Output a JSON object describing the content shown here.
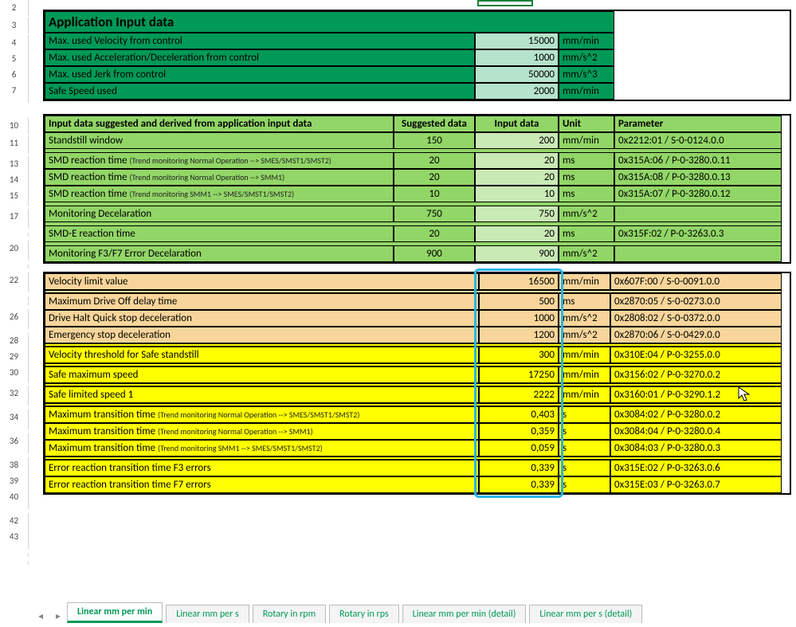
{
  "rownums": [
    "2",
    "3",
    "4",
    "5",
    "6",
    "7",
    "10",
    "11",
    "13",
    "14",
    "15",
    "17",
    "20",
    "22",
    "26",
    "28",
    "29",
    "30",
    "32",
    "34",
    "36",
    "38",
    "39",
    "40",
    "42",
    "43"
  ],
  "rownums_short_after": [
    "7",
    "11",
    "15",
    "17",
    "20",
    "22",
    "26",
    "30",
    "32",
    "34",
    "36",
    "40",
    "43"
  ],
  "section1": {
    "title": "Application Input data",
    "rows": [
      {
        "label": "Max. used Velocity from control",
        "value": "15000",
        "unit": "mm/min"
      },
      {
        "label": "Max. used Acceleration/Deceleration from control",
        "value": "1000",
        "unit": "mm/s^2"
      },
      {
        "label": "Max. used Jerk from control",
        "value": "50000",
        "unit": "mm/s^3"
      },
      {
        "label": "Safe Speed used",
        "value": "2000",
        "unit": "mm/min"
      }
    ]
  },
  "section2": {
    "headers": {
      "label": "Input data suggested and derived from application input data",
      "suggested": "Suggested data",
      "input": "Input data",
      "unit": "Unit",
      "param": "Parameter"
    },
    "rows": [
      {
        "label": "Standstill window",
        "sub": "",
        "suggested": "150",
        "value": "200",
        "unit": "mm/min",
        "param": "0x2212:01 / S-0-0124.0.0"
      },
      null,
      {
        "label": "SMD reaction time ",
        "sub": "(Trend monitoring Normal Operation --> SMES/SMST1/SMST2)",
        "suggested": "20",
        "value": "20",
        "unit": "ms",
        "param": "0x315A:06 / P-0-3280.0.11"
      },
      {
        "label": "SMD reaction time ",
        "sub": "(Trend monitoring Normal Operation --> SMM1)",
        "suggested": "20",
        "value": "20",
        "unit": "ms",
        "param": "0x315A:08 / P-0-3280.0.13"
      },
      {
        "label": "SMD reaction time ",
        "sub": "(Trend monitoring SMM1 --> SMES/SMST1/SMST2)",
        "suggested": "10",
        "value": "10",
        "unit": "ms",
        "param": "0x315A:07 / P-0-3280.0.12"
      },
      null,
      {
        "label": "Monitoring Decelaration",
        "sub": "",
        "suggested": "750",
        "value": "750",
        "unit": "mm/s^2",
        "param": ""
      },
      null,
      {
        "label": "SMD-E reaction time",
        "sub": "",
        "suggested": "20",
        "value": "20",
        "unit": "ms",
        "param": "0x315F:02 / P-0-3263.0.3"
      },
      null,
      {
        "label": "Monitoring F3/F7 Error Decelaration",
        "sub": "",
        "suggested": "900",
        "value": "900",
        "unit": "mm/s^2",
        "param": ""
      }
    ]
  },
  "section3": {
    "blocks": [
      {
        "color": "tan",
        "rows": [
          {
            "label": "Velocity limit value",
            "sub": "",
            "value": "16500",
            "unit": "mm/min",
            "param": "0x607F:00 / S-0-0091.0.0"
          }
        ]
      },
      {
        "color": "tan",
        "rows": [
          {
            "label": "Maximum Drive Off delay time",
            "sub": "",
            "value": "500",
            "unit": "ms",
            "param": "0x2870:05 / S-0-0273.0.0"
          },
          {
            "label": "Drive Halt Quick stop deceleration",
            "sub": "",
            "value": "1000",
            "unit": "mm/s^2",
            "param": "0x2808:02 / S-0-0372.0.0"
          },
          {
            "label": "Emergency stop deceleration",
            "sub": "",
            "value": "1200",
            "unit": "mm/s^2",
            "param": "0x2870:06 / S-0-0429.0.0"
          }
        ]
      },
      {
        "color": "yel",
        "rows": [
          {
            "label": "Velocity threshold for Safe standstill",
            "sub": "",
            "value": "300",
            "unit": "mm/min",
            "param": "0x310E:04 / P-0-3255.0.0"
          }
        ]
      },
      {
        "color": "yel",
        "rows": [
          {
            "label": "Safe maximum speed",
            "sub": "",
            "value": "17250",
            "unit": "mm/min",
            "param": "0x3156:02 / P-0-3270.0.2"
          }
        ]
      },
      {
        "color": "yel",
        "rows": [
          {
            "label": "Safe limited speed 1",
            "sub": "",
            "value": "2222",
            "unit": "mm/min",
            "param": "0x3160:01 / P-0-3290.1.2"
          }
        ]
      },
      {
        "color": "yel",
        "rows": [
          {
            "label": "Maximum transition time ",
            "sub": "(Trend monitoring Normal Operation --> SMES/SMST1/SMST2)",
            "value": "0,403",
            "unit": "s",
            "param": "0x3084:02 / P-0-3280.0.2"
          },
          {
            "label": "Maximum transition time ",
            "sub": "(Trend monitoring Normal Operation --> SMM1)",
            "value": "0,359",
            "unit": "s",
            "param": "0x3084:04 / P-0-3280.0.4"
          },
          {
            "label": "Maximum transition time ",
            "sub": "(Trend monitoring SMM1 --> SMES/SMST1/SMST2)",
            "value": "0,059",
            "unit": "s",
            "param": "0x3084:03 / P-0-3280.0.3"
          }
        ]
      },
      {
        "color": "yel",
        "rows": [
          {
            "label": "Error reaction transition time F3 errors",
            "sub": "",
            "value": "0,339",
            "unit": "s",
            "param": "0x315E:02 / P-0-3263.0.6"
          },
          {
            "label": "Error reaction transition time F7 errors",
            "sub": "",
            "value": "0,339",
            "unit": "s",
            "param": "0x315E:03 / P-0-3263.0.7"
          }
        ]
      }
    ]
  },
  "tabs": [
    {
      "label": "Linear mm per min",
      "active": true
    },
    {
      "label": "Linear mm per s",
      "active": false
    },
    {
      "label": "Rotary in rpm",
      "active": false
    },
    {
      "label": "Rotary in rps",
      "active": false
    },
    {
      "label": "Linear mm per min (detail)",
      "active": false
    },
    {
      "label": "Linear mm per s (detail)",
      "active": false
    }
  ]
}
